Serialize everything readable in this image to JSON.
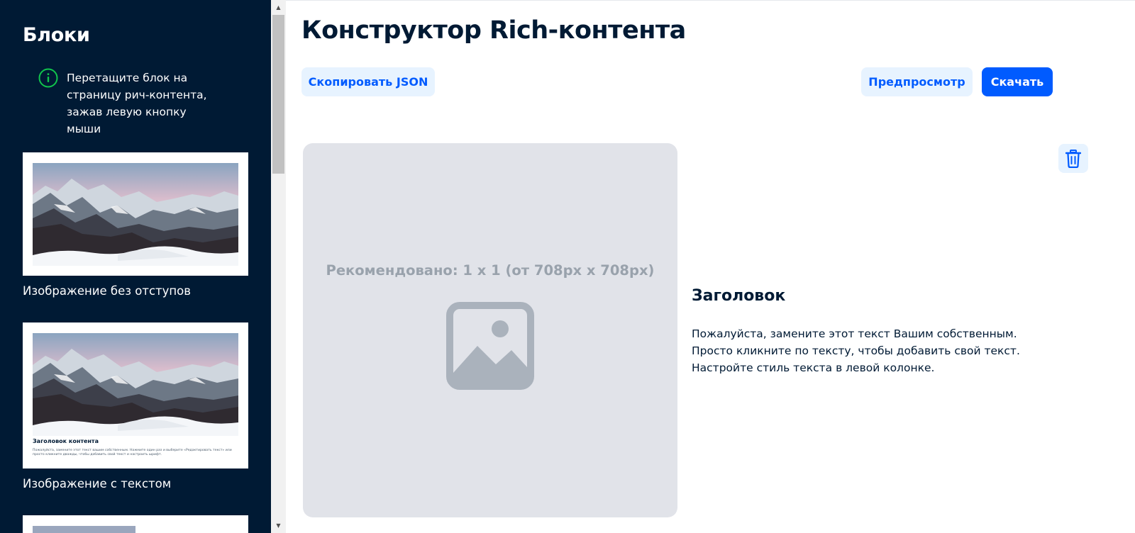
{
  "sidebar": {
    "title": "Блоки",
    "hint": "Перетащите блок на страницу рич-контента, зажав левую кнопку мыши",
    "blocks": [
      {
        "caption": "Изображение без отступов"
      },
      {
        "caption": "Изображение с текстом",
        "preview_heading": "Заголовок контента",
        "preview_text": "Пожалуйста, замените этот текст вашим собственным. Нажмите один раз и выберите «Редактировать текст» или просто кликните дважды, чтобы добавить свой текст и настроить шрифт."
      }
    ]
  },
  "header": {
    "title": "Конструктор Rich-контента"
  },
  "toolbar": {
    "copy_json_label": "Скопировать JSON",
    "preview_label": "Предпросмотр",
    "download_label": "Скачать"
  },
  "editor": {
    "image_placeholder": "Рекомендовано: 1 x 1 (от 708px x 708px)",
    "heading": "Заголовок",
    "body_lines": [
      "Пожалуйста, замените этот текст Вашим собственным.",
      "Просто кликните по тексту, чтобы добавить свой текст.",
      "Настройте стиль текста в левой колонке."
    ]
  },
  "colors": {
    "sidebar_bg": "#001a34",
    "accent": "#005bff",
    "light_button": "#e7f3ff",
    "placeholder_bg": "#e1e3e9",
    "hint_icon": "#10c44c"
  },
  "icons": {
    "hint": "info-icon",
    "delete": "trash-icon",
    "placeholder": "image-icon"
  }
}
